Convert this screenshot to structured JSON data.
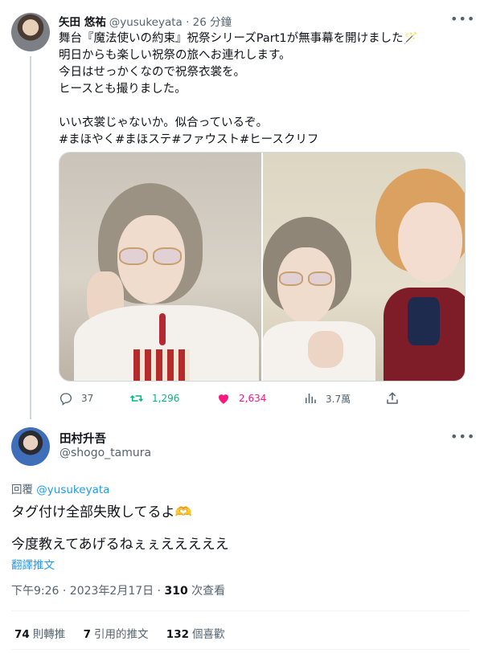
{
  "parent_tweet": {
    "author_name": "矢田 悠祐",
    "meta": "@yusukeyata · 26 分鐘",
    "lines": [
      "舞台『魔法使いの約束』祝祭シリーズPart1が無事幕を開けました🪄",
      "明日からも楽しい祝祭の旅へお連れします。",
      "今日はせっかくなので祝祭衣裳を。",
      "ヒースとも撮りました。",
      "",
      "いい衣裳じゃないか。似合っているぞ。"
    ],
    "hashtags": [
      "#まほやく",
      "#まほステ",
      "#ファウスト",
      "#ヒースクリフ"
    ],
    "more_icon": "more-dots-icon",
    "actions": {
      "reply": {
        "icon": "reply-icon",
        "count": "37"
      },
      "retweet": {
        "icon": "retweet-icon",
        "count": "1,296"
      },
      "like": {
        "icon": "heart-icon",
        "count": "2,634"
      },
      "views": {
        "icon": "views-icon",
        "count": "3.7萬"
      },
      "share": {
        "icon": "share-icon"
      }
    }
  },
  "main_tweet": {
    "author_name": "田村升吾",
    "handle": "@shogo_tamura",
    "reply_prefix": "回覆",
    "reply_to": "@yusukeyata",
    "text_line1": "タグ付け全部失敗してるよ🫶",
    "text_line2": "今度教えてあげるねぇぇえええええ",
    "translate": "翻譯推文",
    "timestamp": "下午9:26 · 2023年2月17日 · ",
    "view_count": "310",
    "view_label": " 次查看",
    "stats": [
      {
        "count": "74",
        "label": "則轉推"
      },
      {
        "count": "7",
        "label": "引用的推文"
      },
      {
        "count": "132",
        "label": "個喜歡"
      }
    ]
  },
  "colors": {
    "text": "#0f1419",
    "secondary": "#536471",
    "link": "#1d9bf0",
    "retweet": "#00ba7c",
    "like": "#f91880"
  }
}
